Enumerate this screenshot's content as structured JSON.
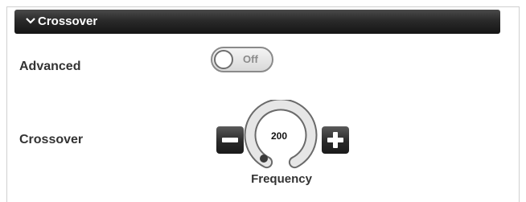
{
  "section": {
    "title": "Crossover",
    "collapse_icon": "chevron-down-icon"
  },
  "advanced": {
    "label": "Advanced",
    "toggle_state": "Off"
  },
  "crossover": {
    "label": "Crossover",
    "frequency_value": "200",
    "frequency_label": "Frequency",
    "decrement_icon": "minus-icon",
    "increment_icon": "plus-icon"
  },
  "colors": {
    "header_bg": "#2a2a2a",
    "header_text": "#ffffff",
    "label_text": "#333333",
    "button_bg": "#2a2a2a",
    "toggle_off_text": "#8a8a8a"
  }
}
